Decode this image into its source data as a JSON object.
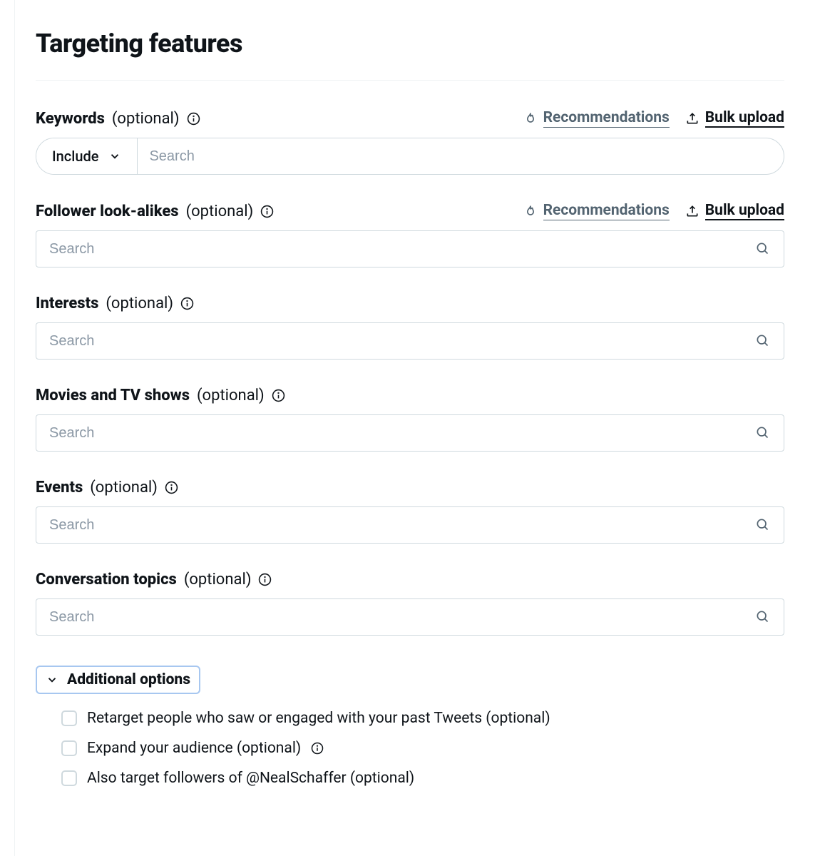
{
  "page": {
    "title": "Targeting features"
  },
  "common": {
    "optional": "(optional)",
    "search_placeholder": "Search",
    "recommendations": "Recommendations",
    "bulk_upload": "Bulk upload"
  },
  "keywords": {
    "label": "Keywords",
    "dropdown_value": "Include"
  },
  "lookalikes": {
    "label": "Follower look-alikes"
  },
  "interests": {
    "label": "Interests"
  },
  "movies": {
    "label": "Movies and TV shows"
  },
  "events": {
    "label": "Events"
  },
  "topics": {
    "label": "Conversation topics"
  },
  "additional": {
    "toggle_label": "Additional options",
    "options": [
      {
        "label": "Retarget people who saw or engaged with your past Tweets (optional)",
        "has_info": false
      },
      {
        "label": "Expand your audience (optional)",
        "has_info": true
      },
      {
        "label": "Also target followers of @NealSchaffer (optional)",
        "has_info": false
      }
    ]
  }
}
